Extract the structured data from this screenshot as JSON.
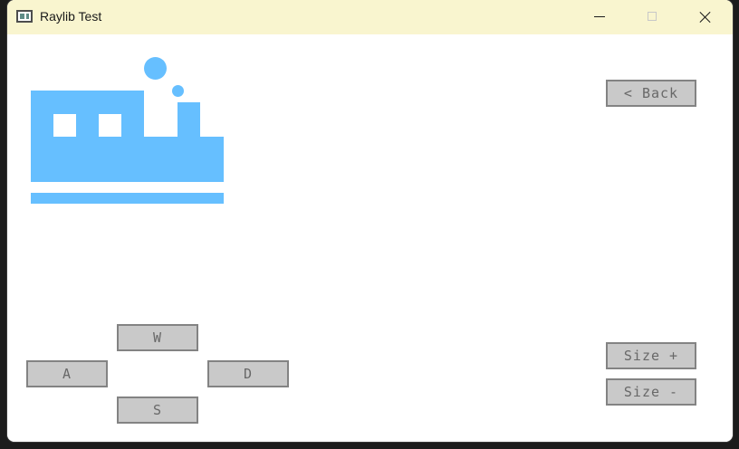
{
  "window": {
    "title": "Raylib Test",
    "controls": {
      "minimize": "minimize-icon",
      "maximize": "maximize-icon",
      "close": "close-icon"
    }
  },
  "game": {
    "back_label": "< Back",
    "controls": {
      "up": "W",
      "left": "A",
      "right": "D",
      "down": "S"
    },
    "size_increase_label": "Size +",
    "size_decrease_label": "Size -",
    "colors": {
      "ship": "#66bfff",
      "button_bg": "#c9c9c9",
      "button_border": "#838383",
      "button_text": "#686868",
      "titlebar": "#f9f5cf"
    }
  }
}
